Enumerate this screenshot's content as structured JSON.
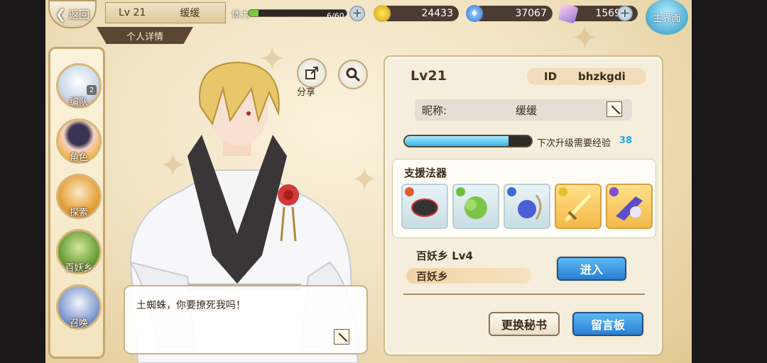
{
  "top": {
    "back_label": "返回",
    "level": "Lv 21",
    "player_name": "缓缓",
    "detail_tab": "个人详情",
    "stamina_label": "体力",
    "stamina_text": "6/60",
    "stamina_fraction": 0.1,
    "gold": "24433",
    "spirit": "37067",
    "gems": "1569",
    "home_label": "主界面"
  },
  "nav": [
    {
      "label": "编队",
      "badge": "2"
    },
    {
      "label": "角色"
    },
    {
      "label": "探索"
    },
    {
      "label": "百妖乡"
    },
    {
      "label": "召唤"
    }
  ],
  "share_label": "分享",
  "dialog": {
    "text": "土蜘蛛，你要撩死我吗！"
  },
  "panel": {
    "level": "Lv21",
    "id_label": "ID",
    "id_value": "bhzkgdi",
    "nickname_label": "昵称:",
    "nickname_value": "缓缓",
    "exp_label": "下次升级需要经验",
    "exp_value": "38",
    "exp_fraction": 0.82,
    "support_title": "支援法器",
    "home_title": "百妖乡  Lv4",
    "home_name": "百妖乡",
    "enter_button": "进入",
    "change_secretary_button": "更换秘书",
    "message_board_button": "留言板"
  },
  "colors": {
    "accent_blue": "#2b7ed3",
    "exp_blue": "#34b6e6",
    "stamina_green": "#79cc3d"
  }
}
